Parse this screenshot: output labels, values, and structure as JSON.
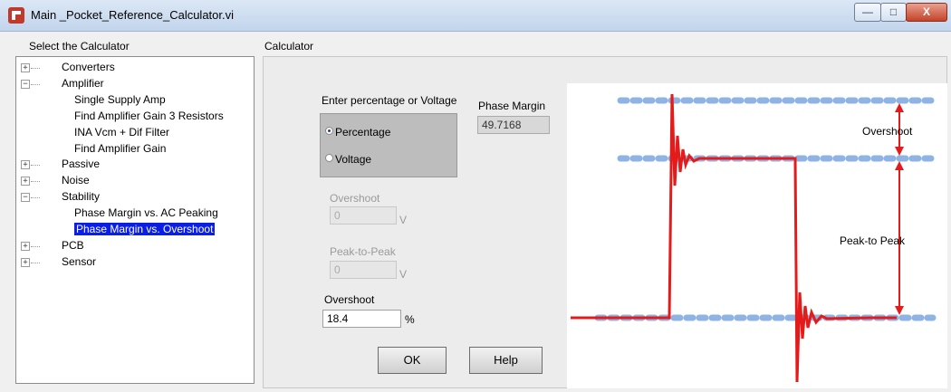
{
  "window": {
    "title": "Main _Pocket_Reference_Calculator.vi",
    "min_symbol": "—",
    "max_symbol": "□",
    "close_symbol": "X"
  },
  "left_panel": {
    "header": "Select the Calculator",
    "tree": [
      {
        "label": "Converters",
        "level": 0,
        "expander": "+"
      },
      {
        "label": "Amplifier",
        "level": 0,
        "expander": "−"
      },
      {
        "label": "Single Supply Amp",
        "level": 1
      },
      {
        "label": "Find Amplifier Gain 3 Resistors",
        "level": 1
      },
      {
        "label": "INA Vcm + Dif Filter",
        "level": 1
      },
      {
        "label": "Find Amplifier Gain",
        "level": 1
      },
      {
        "label": "Passive",
        "level": 0,
        "expander": "+"
      },
      {
        "label": "Noise",
        "level": 0,
        "expander": "+"
      },
      {
        "label": "Stability",
        "level": 0,
        "expander": "−"
      },
      {
        "label": "Phase Margin vs. AC Peaking",
        "level": 1
      },
      {
        "label": "Phase Margin vs. Overshoot",
        "level": 1,
        "selected": true
      },
      {
        "label": "PCB",
        "level": 0,
        "expander": "+"
      },
      {
        "label": "Sensor",
        "level": 0,
        "expander": "+"
      }
    ]
  },
  "calculator": {
    "header": "Calculator",
    "mode_group": {
      "label": "Enter percentage or Voltage",
      "options": [
        "Percentage",
        "Voltage"
      ],
      "selected": "Percentage"
    },
    "phase_margin": {
      "label": "Phase Margin",
      "value": "49.7168"
    },
    "overshoot_v": {
      "label": "Overshoot",
      "value": "0",
      "unit": "V"
    },
    "peak_to_peak": {
      "label": "Peak-to-Peak",
      "value": "0",
      "unit": "V"
    },
    "overshoot_pct": {
      "label": "Overshoot",
      "value": "18.4",
      "unit": "%"
    },
    "ok_label": "OK",
    "help_label": "Help"
  },
  "diagram": {
    "overshoot_label": "Overshoot",
    "peak_label": "Peak-to Peak",
    "colors": {
      "signal": "#e31b1b",
      "guide": "#8fb4e3"
    }
  }
}
